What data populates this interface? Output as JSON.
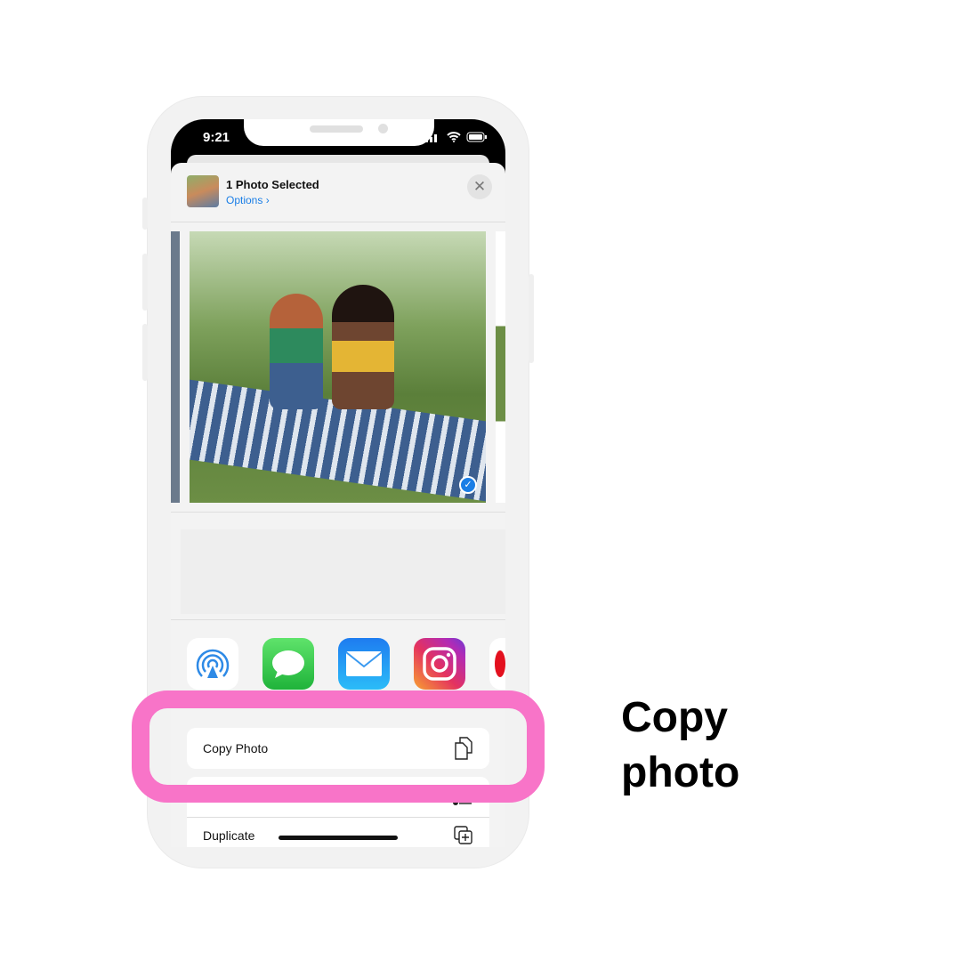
{
  "status_bar": {
    "time": "9:21"
  },
  "share_sheet": {
    "title": "1 Photo Selected",
    "options_label": "Options ›",
    "close_icon": "✕",
    "selected_check": "✓",
    "apps": [
      {
        "icon": "airdrop-icon"
      },
      {
        "icon": "messages-icon"
      },
      {
        "icon": "mail-icon"
      },
      {
        "icon": "instagram-icon"
      },
      {
        "icon": "partial-app-icon"
      }
    ],
    "actions": [
      {
        "label": "Copy Photo",
        "icon": "copy-icon"
      },
      {
        "label": "",
        "icon": "hidden-action-icon"
      },
      {
        "label": "Duplicate",
        "icon": "duplicate-icon"
      }
    ]
  },
  "caption": "Copy photo",
  "colors": {
    "highlight": "#f874c8",
    "link": "#1a7ee6"
  }
}
